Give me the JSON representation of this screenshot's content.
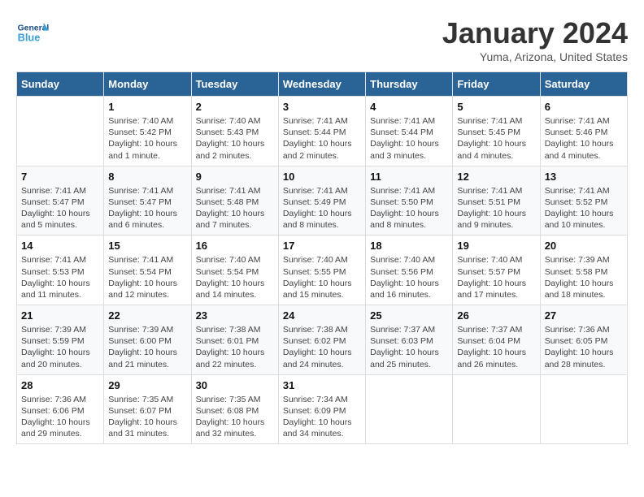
{
  "logo": {
    "general": "General",
    "blue": "Blue"
  },
  "title": "January 2024",
  "location": "Yuma, Arizona, United States",
  "days_of_week": [
    "Sunday",
    "Monday",
    "Tuesday",
    "Wednesday",
    "Thursday",
    "Friday",
    "Saturday"
  ],
  "weeks": [
    [
      {
        "day": "",
        "info": ""
      },
      {
        "day": "1",
        "info": "Sunrise: 7:40 AM\nSunset: 5:42 PM\nDaylight: 10 hours\nand 1 minute."
      },
      {
        "day": "2",
        "info": "Sunrise: 7:40 AM\nSunset: 5:43 PM\nDaylight: 10 hours\nand 2 minutes."
      },
      {
        "day": "3",
        "info": "Sunrise: 7:41 AM\nSunset: 5:44 PM\nDaylight: 10 hours\nand 2 minutes."
      },
      {
        "day": "4",
        "info": "Sunrise: 7:41 AM\nSunset: 5:44 PM\nDaylight: 10 hours\nand 3 minutes."
      },
      {
        "day": "5",
        "info": "Sunrise: 7:41 AM\nSunset: 5:45 PM\nDaylight: 10 hours\nand 4 minutes."
      },
      {
        "day": "6",
        "info": "Sunrise: 7:41 AM\nSunset: 5:46 PM\nDaylight: 10 hours\nand 4 minutes."
      }
    ],
    [
      {
        "day": "7",
        "info": "Sunrise: 7:41 AM\nSunset: 5:47 PM\nDaylight: 10 hours\nand 5 minutes."
      },
      {
        "day": "8",
        "info": "Sunrise: 7:41 AM\nSunset: 5:47 PM\nDaylight: 10 hours\nand 6 minutes."
      },
      {
        "day": "9",
        "info": "Sunrise: 7:41 AM\nSunset: 5:48 PM\nDaylight: 10 hours\nand 7 minutes."
      },
      {
        "day": "10",
        "info": "Sunrise: 7:41 AM\nSunset: 5:49 PM\nDaylight: 10 hours\nand 8 minutes."
      },
      {
        "day": "11",
        "info": "Sunrise: 7:41 AM\nSunset: 5:50 PM\nDaylight: 10 hours\nand 8 minutes."
      },
      {
        "day": "12",
        "info": "Sunrise: 7:41 AM\nSunset: 5:51 PM\nDaylight: 10 hours\nand 9 minutes."
      },
      {
        "day": "13",
        "info": "Sunrise: 7:41 AM\nSunset: 5:52 PM\nDaylight: 10 hours\nand 10 minutes."
      }
    ],
    [
      {
        "day": "14",
        "info": "Sunrise: 7:41 AM\nSunset: 5:53 PM\nDaylight: 10 hours\nand 11 minutes."
      },
      {
        "day": "15",
        "info": "Sunrise: 7:41 AM\nSunset: 5:54 PM\nDaylight: 10 hours\nand 12 minutes."
      },
      {
        "day": "16",
        "info": "Sunrise: 7:40 AM\nSunset: 5:54 PM\nDaylight: 10 hours\nand 14 minutes."
      },
      {
        "day": "17",
        "info": "Sunrise: 7:40 AM\nSunset: 5:55 PM\nDaylight: 10 hours\nand 15 minutes."
      },
      {
        "day": "18",
        "info": "Sunrise: 7:40 AM\nSunset: 5:56 PM\nDaylight: 10 hours\nand 16 minutes."
      },
      {
        "day": "19",
        "info": "Sunrise: 7:40 AM\nSunset: 5:57 PM\nDaylight: 10 hours\nand 17 minutes."
      },
      {
        "day": "20",
        "info": "Sunrise: 7:39 AM\nSunset: 5:58 PM\nDaylight: 10 hours\nand 18 minutes."
      }
    ],
    [
      {
        "day": "21",
        "info": "Sunrise: 7:39 AM\nSunset: 5:59 PM\nDaylight: 10 hours\nand 20 minutes."
      },
      {
        "day": "22",
        "info": "Sunrise: 7:39 AM\nSunset: 6:00 PM\nDaylight: 10 hours\nand 21 minutes."
      },
      {
        "day": "23",
        "info": "Sunrise: 7:38 AM\nSunset: 6:01 PM\nDaylight: 10 hours\nand 22 minutes."
      },
      {
        "day": "24",
        "info": "Sunrise: 7:38 AM\nSunset: 6:02 PM\nDaylight: 10 hours\nand 24 minutes."
      },
      {
        "day": "25",
        "info": "Sunrise: 7:37 AM\nSunset: 6:03 PM\nDaylight: 10 hours\nand 25 minutes."
      },
      {
        "day": "26",
        "info": "Sunrise: 7:37 AM\nSunset: 6:04 PM\nDaylight: 10 hours\nand 26 minutes."
      },
      {
        "day": "27",
        "info": "Sunrise: 7:36 AM\nSunset: 6:05 PM\nDaylight: 10 hours\nand 28 minutes."
      }
    ],
    [
      {
        "day": "28",
        "info": "Sunrise: 7:36 AM\nSunset: 6:06 PM\nDaylight: 10 hours\nand 29 minutes."
      },
      {
        "day": "29",
        "info": "Sunrise: 7:35 AM\nSunset: 6:07 PM\nDaylight: 10 hours\nand 31 minutes."
      },
      {
        "day": "30",
        "info": "Sunrise: 7:35 AM\nSunset: 6:08 PM\nDaylight: 10 hours\nand 32 minutes."
      },
      {
        "day": "31",
        "info": "Sunrise: 7:34 AM\nSunset: 6:09 PM\nDaylight: 10 hours\nand 34 minutes."
      },
      {
        "day": "",
        "info": ""
      },
      {
        "day": "",
        "info": ""
      },
      {
        "day": "",
        "info": ""
      }
    ]
  ]
}
